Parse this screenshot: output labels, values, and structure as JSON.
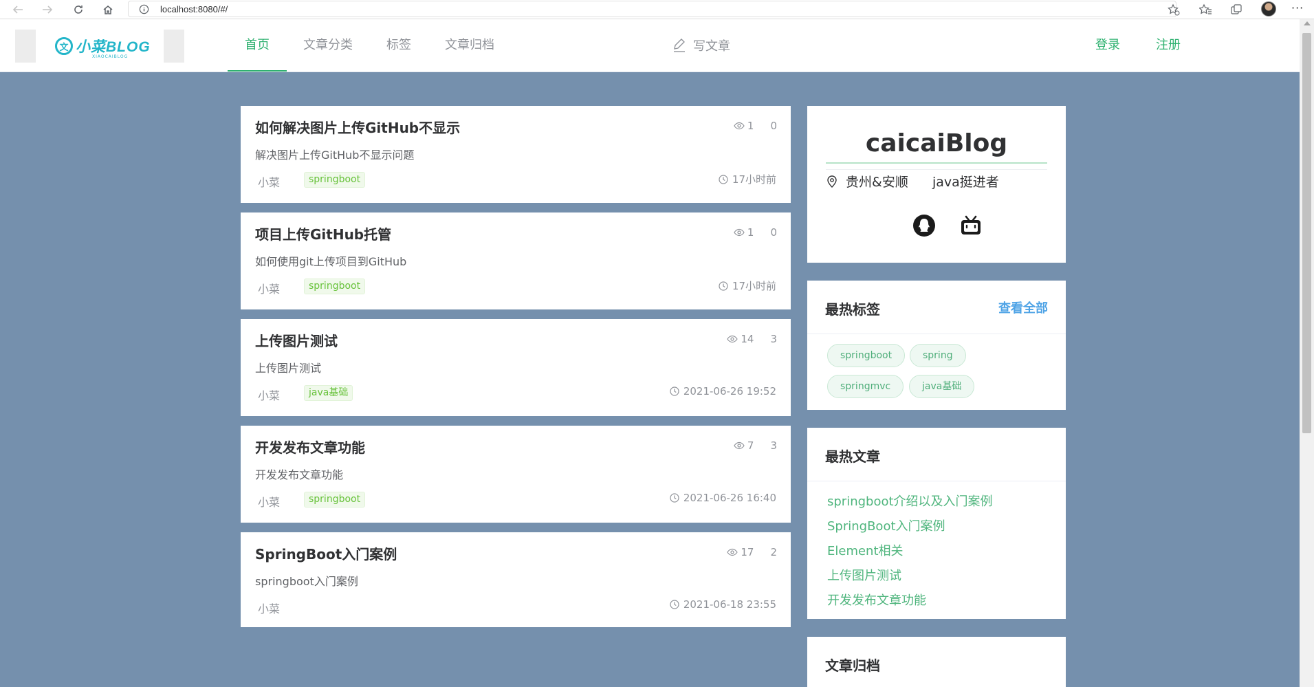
{
  "browser": {
    "url": "localhost:8080/#/"
  },
  "nav": {
    "items": [
      "首页",
      "文章分类",
      "标签",
      "文章归档"
    ],
    "active_index": 0,
    "write_label": "写文章",
    "login_label": "登录",
    "register_label": "注册"
  },
  "logo": {
    "text": "小菜BLOG",
    "subtext": "XIAOCAIBLOG"
  },
  "articles": [
    {
      "title": "如何解决图片上传GitHub不显示",
      "views": "1",
      "comments": "0",
      "summary": "解决图片上传GitHub不显示问题",
      "author": "小菜",
      "tag": "springboot",
      "time": "17小时前"
    },
    {
      "title": "项目上传GitHub托管",
      "views": "1",
      "comments": "0",
      "summary": "如何使用git上传项目到GitHub",
      "author": "小菜",
      "tag": "springboot",
      "time": "17小时前"
    },
    {
      "title": "上传图片测试",
      "views": "14",
      "comments": "3",
      "summary": "上传图片测试",
      "author": "小菜",
      "tag": "java基础",
      "time": "2021-06-26 19:52"
    },
    {
      "title": "开发发布文章功能",
      "views": "7",
      "comments": "3",
      "summary": "开发发布文章功能",
      "author": "小菜",
      "tag": "springboot",
      "time": "2021-06-26 16:40"
    },
    {
      "title": "SpringBoot入门案例",
      "views": "17",
      "comments": "2",
      "summary": "springboot入门案例",
      "author": "小菜",
      "tag": "",
      "time": "2021-06-18 23:55"
    }
  ],
  "profile": {
    "name": "caicaiBlog",
    "location": "贵州&安顺",
    "description": "java挺进者",
    "social_icons": [
      "qq-icon",
      "bilibili-icon"
    ]
  },
  "hot_tags": {
    "title": "最热标签",
    "see_all": "查看全部",
    "tags": [
      "springboot",
      "spring",
      "springmvc",
      "java基础"
    ]
  },
  "hot_articles": {
    "title": "最热文章",
    "items": [
      "springboot介绍以及入门案例",
      "SpringBoot入门案例",
      "Element相关",
      "上传图片测试",
      "开发发布文章功能"
    ]
  },
  "archive": {
    "title": "文章归档"
  },
  "colors": {
    "background": "#7590ad",
    "accent": "#2fb170",
    "link_blue": "#4ea3e6",
    "tag_green": "#67c23a"
  }
}
